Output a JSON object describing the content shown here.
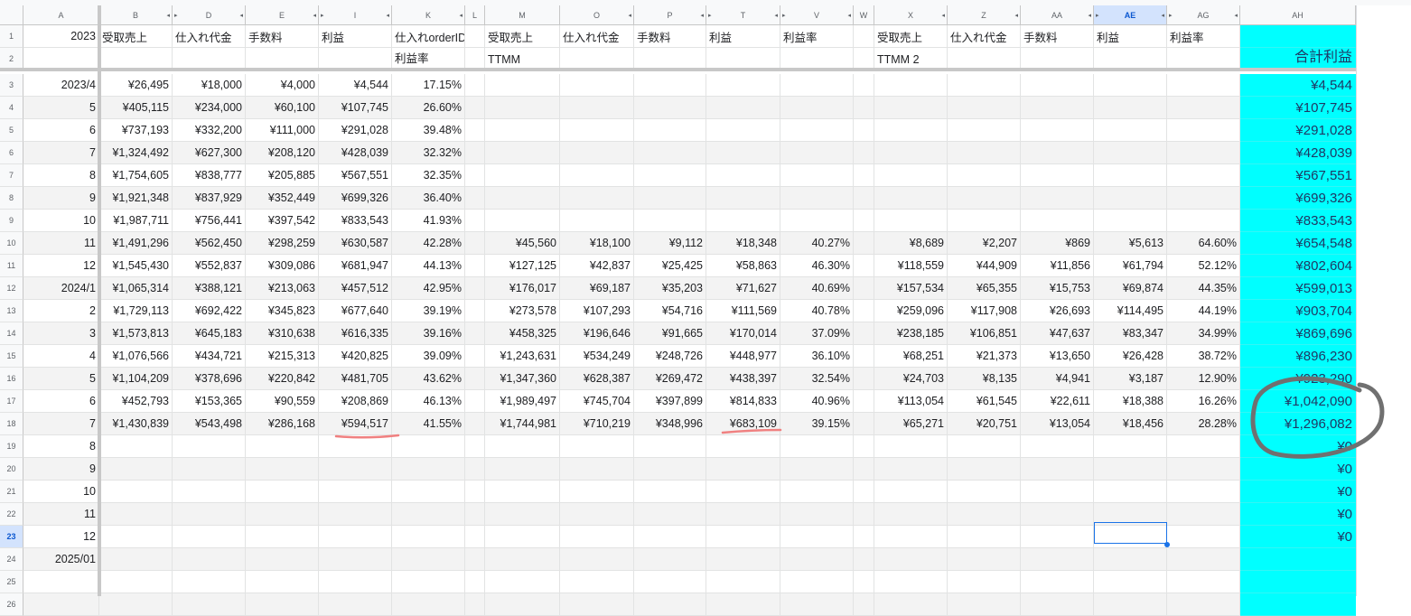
{
  "columns": [
    "A",
    "B",
    "D",
    "E",
    "I",
    "K",
    "L",
    "M",
    "O",
    "P",
    "T",
    "V",
    "W",
    "X",
    "Z",
    "AA",
    "AE",
    "AG",
    "AH"
  ],
  "selected_column": "AE",
  "selected_row": "23",
  "header_row_1": [
    "2023",
    "受取売上",
    "仕入れ代金",
    "手数料",
    "利益",
    "仕入れorderID",
    "",
    "受取売上",
    "仕入れ代金",
    "手数料",
    "利益",
    "利益率",
    "",
    "受取売上",
    "仕入れ代金",
    "手数料",
    "利益",
    "利益率",
    ""
  ],
  "header_row_2": [
    "",
    "",
    "",
    "",
    "",
    "利益率",
    "",
    "TTMM",
    "",
    "",
    "",
    "",
    "",
    "TTMM 2",
    "",
    "",
    "",
    "",
    "合計利益"
  ],
  "data_rows": [
    {
      "num": "3",
      "cells": [
        "2023/4",
        "¥26,495",
        "¥18,000",
        "¥4,000",
        "¥4,544",
        "17.15%",
        "",
        "",
        "",
        "",
        "",
        "",
        "",
        "",
        "",
        "",
        "",
        "",
        "¥4,544"
      ]
    },
    {
      "num": "4",
      "cells": [
        "5",
        "¥405,115",
        "¥234,000",
        "¥60,100",
        "¥107,745",
        "26.60%",
        "",
        "",
        "",
        "",
        "",
        "",
        "",
        "",
        "",
        "",
        "",
        "",
        "¥107,745"
      ]
    },
    {
      "num": "5",
      "cells": [
        "6",
        "¥737,193",
        "¥332,200",
        "¥111,000",
        "¥291,028",
        "39.48%",
        "",
        "",
        "",
        "",
        "",
        "",
        "",
        "",
        "",
        "",
        "",
        "",
        "¥291,028"
      ]
    },
    {
      "num": "6",
      "cells": [
        "7",
        "¥1,324,492",
        "¥627,300",
        "¥208,120",
        "¥428,039",
        "32.32%",
        "",
        "",
        "",
        "",
        "",
        "",
        "",
        "",
        "",
        "",
        "",
        "",
        "¥428,039"
      ]
    },
    {
      "num": "7",
      "cells": [
        "8",
        "¥1,754,605",
        "¥838,777",
        "¥205,885",
        "¥567,551",
        "32.35%",
        "",
        "",
        "",
        "",
        "",
        "",
        "",
        "",
        "",
        "",
        "",
        "",
        "¥567,551"
      ]
    },
    {
      "num": "8",
      "cells": [
        "9",
        "¥1,921,348",
        "¥837,929",
        "¥352,449",
        "¥699,326",
        "36.40%",
        "",
        "",
        "",
        "",
        "",
        "",
        "",
        "",
        "",
        "",
        "",
        "",
        "¥699,326"
      ]
    },
    {
      "num": "9",
      "cells": [
        "10",
        "¥1,987,711",
        "¥756,441",
        "¥397,542",
        "¥833,543",
        "41.93%",
        "",
        "",
        "",
        "",
        "",
        "",
        "",
        "",
        "",
        "",
        "",
        "",
        "¥833,543"
      ]
    },
    {
      "num": "10",
      "cells": [
        "11",
        "¥1,491,296",
        "¥562,450",
        "¥298,259",
        "¥630,587",
        "42.28%",
        "",
        "¥45,560",
        "¥18,100",
        "¥9,112",
        "¥18,348",
        "40.27%",
        "",
        "¥8,689",
        "¥2,207",
        "¥869",
        "¥5,613",
        "64.60%",
        "¥654,548"
      ]
    },
    {
      "num": "11",
      "cells": [
        "12",
        "¥1,545,430",
        "¥552,837",
        "¥309,086",
        "¥681,947",
        "44.13%",
        "",
        "¥127,125",
        "¥42,837",
        "¥25,425",
        "¥58,863",
        "46.30%",
        "",
        "¥118,559",
        "¥44,909",
        "¥11,856",
        "¥61,794",
        "52.12%",
        "¥802,604"
      ]
    },
    {
      "num": "12",
      "cells": [
        "2024/1",
        "¥1,065,314",
        "¥388,121",
        "¥213,063",
        "¥457,512",
        "42.95%",
        "",
        "¥176,017",
        "¥69,187",
        "¥35,203",
        "¥71,627",
        "40.69%",
        "",
        "¥157,534",
        "¥65,355",
        "¥15,753",
        "¥69,874",
        "44.35%",
        "¥599,013"
      ]
    },
    {
      "num": "13",
      "cells": [
        "2",
        "¥1,729,113",
        "¥692,422",
        "¥345,823",
        "¥677,640",
        "39.19%",
        "",
        "¥273,578",
        "¥107,293",
        "¥54,716",
        "¥111,569",
        "40.78%",
        "",
        "¥259,096",
        "¥117,908",
        "¥26,693",
        "¥114,495",
        "44.19%",
        "¥903,704"
      ]
    },
    {
      "num": "14",
      "cells": [
        "3",
        "¥1,573,813",
        "¥645,183",
        "¥310,638",
        "¥616,335",
        "39.16%",
        "",
        "¥458,325",
        "¥196,646",
        "¥91,665",
        "¥170,014",
        "37.09%",
        "",
        "¥238,185",
        "¥106,851",
        "¥47,637",
        "¥83,347",
        "34.99%",
        "¥869,696"
      ]
    },
    {
      "num": "15",
      "cells": [
        "4",
        "¥1,076,566",
        "¥434,721",
        "¥215,313",
        "¥420,825",
        "39.09%",
        "",
        "¥1,243,631",
        "¥534,249",
        "¥248,726",
        "¥448,977",
        "36.10%",
        "",
        "¥68,251",
        "¥21,373",
        "¥13,650",
        "¥26,428",
        "38.72%",
        "¥896,230"
      ]
    },
    {
      "num": "16",
      "cells": [
        "5",
        "¥1,104,209",
        "¥378,696",
        "¥220,842",
        "¥481,705",
        "43.62%",
        "",
        "¥1,347,360",
        "¥628,387",
        "¥269,472",
        "¥438,397",
        "32.54%",
        "",
        "¥24,703",
        "¥8,135",
        "¥4,941",
        "¥3,187",
        "12.90%",
        "¥923,290"
      ]
    },
    {
      "num": "17",
      "cells": [
        "6",
        "¥452,793",
        "¥153,365",
        "¥90,559",
        "¥208,869",
        "46.13%",
        "",
        "¥1,989,497",
        "¥745,704",
        "¥397,899",
        "¥814,833",
        "40.96%",
        "",
        "¥113,054",
        "¥61,545",
        "¥22,611",
        "¥18,388",
        "16.26%",
        "¥1,042,090"
      ]
    },
    {
      "num": "18",
      "cells": [
        "7",
        "¥1,430,839",
        "¥543,498",
        "¥286,168",
        "¥594,517",
        "41.55%",
        "",
        "¥1,744,981",
        "¥710,219",
        "¥348,996",
        "¥683,109",
        "39.15%",
        "",
        "¥65,271",
        "¥20,751",
        "¥13,054",
        "¥18,456",
        "28.28%",
        "¥1,296,082"
      ]
    },
    {
      "num": "19",
      "cells": [
        "8",
        "",
        "",
        "",
        "",
        "",
        "",
        "",
        "",
        "",
        "",
        "",
        "",
        "",
        "",
        "",
        "",
        "",
        "¥0"
      ]
    },
    {
      "num": "20",
      "cells": [
        "9",
        "",
        "",
        "",
        "",
        "",
        "",
        "",
        "",
        "",
        "",
        "",
        "",
        "",
        "",
        "",
        "",
        "",
        "¥0"
      ]
    },
    {
      "num": "21",
      "cells": [
        "10",
        "",
        "",
        "",
        "",
        "",
        "",
        "",
        "",
        "",
        "",
        "",
        "",
        "",
        "",
        "",
        "",
        "",
        "¥0"
      ]
    },
    {
      "num": "22",
      "cells": [
        "11",
        "",
        "",
        "",
        "",
        "",
        "",
        "",
        "",
        "",
        "",
        "",
        "",
        "",
        "",
        "",
        "",
        "",
        "¥0"
      ]
    },
    {
      "num": "23",
      "cells": [
        "12",
        "",
        "",
        "",
        "",
        "",
        "",
        "",
        "",
        "",
        "",
        "",
        "",
        "",
        "",
        "",
        "",
        "",
        "¥0"
      ]
    },
    {
      "num": "24",
      "cells": [
        "2025/01",
        "",
        "",
        "",
        "",
        "",
        "",
        "",
        "",
        "",
        "",
        "",
        "",
        "",
        "",
        "",
        "",
        "",
        ""
      ]
    },
    {
      "num": "25",
      "cells": [
        "",
        "",
        "",
        "",
        "",
        "",
        "",
        "",
        "",
        "",
        "",
        "",
        "",
        "",
        "",
        "",
        "",
        "",
        ""
      ]
    },
    {
      "num": "26",
      "cells": [
        "",
        "",
        "",
        "",
        "",
        "",
        "",
        "",
        "",
        "",
        "",
        "",
        "",
        "",
        "",
        "",
        "",
        "",
        ""
      ]
    }
  ],
  "colors": {
    "total_column": "#00ffff",
    "annotation_underline": "#f08080",
    "annotation_circle": "#707070",
    "selection": "#1a73e8"
  }
}
